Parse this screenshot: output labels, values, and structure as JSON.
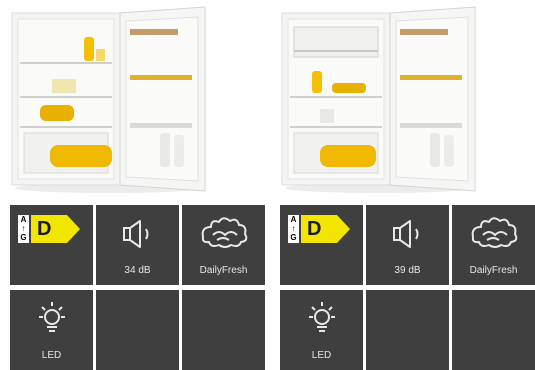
{
  "colors": {
    "tile_bg": "#3f3f3f",
    "tile_text": "#e6e6e6",
    "energy_arrow": "#f2e600"
  },
  "products": [
    {
      "image": "fridge-image",
      "features": {
        "energy": {
          "top": "A",
          "arrow": "↑",
          "bottom": "G",
          "grade": "D"
        },
        "noise": {
          "icon": "speaker-icon",
          "label": "34 dB"
        },
        "freshness": {
          "icon": "dailyfresh-icon",
          "label": "DailyFresh"
        },
        "light": {
          "icon": "light-bulb-icon",
          "label": "LED"
        }
      }
    },
    {
      "image": "fridge-freezer-compartment-image",
      "features": {
        "energy": {
          "top": "A",
          "arrow": "↑",
          "bottom": "G",
          "grade": "D"
        },
        "noise": {
          "icon": "speaker-icon",
          "label": "39 dB"
        },
        "freshness": {
          "icon": "dailyfresh-icon",
          "label": "DailyFresh"
        },
        "light": {
          "icon": "light-bulb-icon",
          "label": "LED"
        }
      }
    }
  ]
}
